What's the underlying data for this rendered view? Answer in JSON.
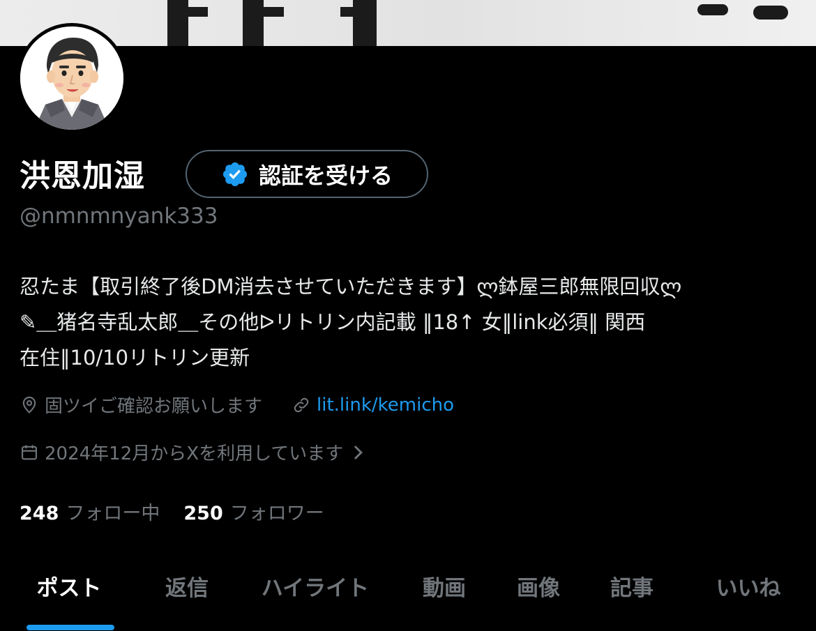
{
  "profile": {
    "display_name": "洪恩加湿",
    "verify_button_label": "認証を受ける",
    "handle": "@nmnmnyank333",
    "bio": "忍たま【取引終了後DM消去させていただきます】ლ鉢屋三郎無限回収ლ\n✎＿猪名寺乱太郎＿その他ᐅリトリン内記載 ‖18↑ 女‖link必須‖ 関西\n在住‖10/10リトリン更新",
    "location": "固ツイご確認お願いします",
    "website": "lit.link/kemicho",
    "joined": "2024年12月からXを利用しています"
  },
  "stats": {
    "following_count": "248",
    "following_label": "フォロー中",
    "followers_count": "250",
    "followers_label": "フォロワー"
  },
  "tabs": [
    "ポスト",
    "返信",
    "ハイライト",
    "動画",
    "画像",
    "記事",
    "いいね"
  ],
  "active_tab": "ポスト",
  "colors": {
    "background": "#000000",
    "accent": "#1d9bf0",
    "secondary_text": "#71767b",
    "border": "#536471"
  },
  "icons": {
    "verify": "verified-badge-icon",
    "location": "location-pin-icon",
    "link": "link-icon",
    "calendar": "calendar-icon",
    "join_chevron": "chevron-right-icon"
  }
}
